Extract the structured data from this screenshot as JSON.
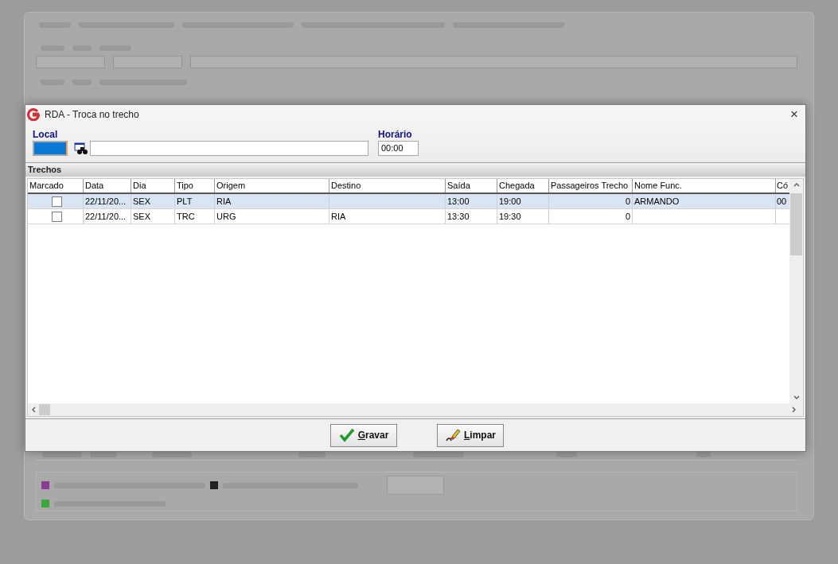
{
  "dialog": {
    "title": "RDA - Troca no trecho",
    "close": "×",
    "local": {
      "label": "Local"
    },
    "horario": {
      "label": "Horário",
      "value": "00:00"
    },
    "section": "Trechos",
    "columns": [
      "Marcado",
      "Data",
      "Dia",
      "Tipo",
      "Origem",
      "Destino",
      "Saída",
      "Chegada",
      "Passageiros Trecho",
      "Nome Func.",
      "Có"
    ],
    "rows": [
      {
        "selected": true,
        "cells": [
          {
            "kind": "check",
            "checked": false
          },
          {
            "text": "22/11/20..."
          },
          {
            "text": "SEX"
          },
          {
            "text": "PLT"
          },
          {
            "text": "RIA"
          },
          {},
          {
            "text": "13:00"
          },
          {
            "text": "19:00"
          },
          {
            "text": "0"
          },
          {
            "text": "ARMANDO"
          },
          {
            "text": "00"
          }
        ]
      },
      {
        "selected": false,
        "cells": [
          {
            "kind": "check",
            "checked": false
          },
          {
            "text": "22/11/20..."
          },
          {
            "text": "SEX"
          },
          {
            "text": "TRC"
          },
          {
            "text": "URG"
          },
          {
            "text": "RIA"
          },
          {
            "text": "13:30"
          },
          {
            "text": "19:30"
          },
          {
            "text": "0"
          },
          {},
          {}
        ]
      }
    ],
    "buttons": [
      {
        "kind": "save",
        "label": "Gravar"
      },
      {
        "kind": "clear",
        "label": "Limpar"
      }
    ]
  }
}
